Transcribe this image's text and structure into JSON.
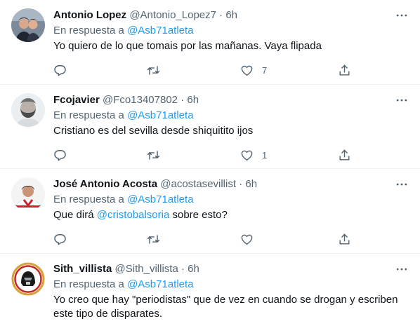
{
  "tweets": [
    {
      "name": "Antonio Lopez",
      "handle": "@Antonio_Lopez7",
      "sep": "·",
      "time": "6h",
      "reply_prefix": "En respuesta a",
      "reply_handle": "@Asb71atleta",
      "text": "Yo quiero de lo que tomais por las mañanas. Vaya flipada",
      "like_count": "7"
    },
    {
      "name": "Fcojavier",
      "handle": "@Fco13407802",
      "sep": "·",
      "time": "6h",
      "reply_prefix": "En respuesta a",
      "reply_handle": "@Asb71atleta",
      "text": "Cristiano es del sevilla desde shiquitito ijos",
      "like_count": "1"
    },
    {
      "name": "José Antonio Acosta",
      "handle": "@acostasevillist",
      "sep": "·",
      "time": "6h",
      "reply_prefix": "En respuesta a",
      "reply_handle": "@Asb71atleta",
      "text_before": "Que dirá",
      "mention": "@cristobalsoria",
      "text_after": "sobre esto?",
      "like_count": ""
    },
    {
      "name": "Sith_villista",
      "handle": "@Sith_villista",
      "sep": "·",
      "time": "6h",
      "reply_prefix": "En respuesta a",
      "reply_handle": "@Asb71atleta",
      "text": "Yo creo que hay \"periodistas\" que de vez en cuando se drogan y escriben este tipo de disparates."
    }
  ],
  "icons": {
    "reply": "reply-icon",
    "retweet": "retweet-icon",
    "like": "like-icon",
    "share": "share-icon",
    "more": "more-icon"
  },
  "colors": {
    "link": "#1d9bf0",
    "secondary_text": "#536471",
    "primary_text": "#0f1419",
    "divider": "#eff3f4"
  }
}
